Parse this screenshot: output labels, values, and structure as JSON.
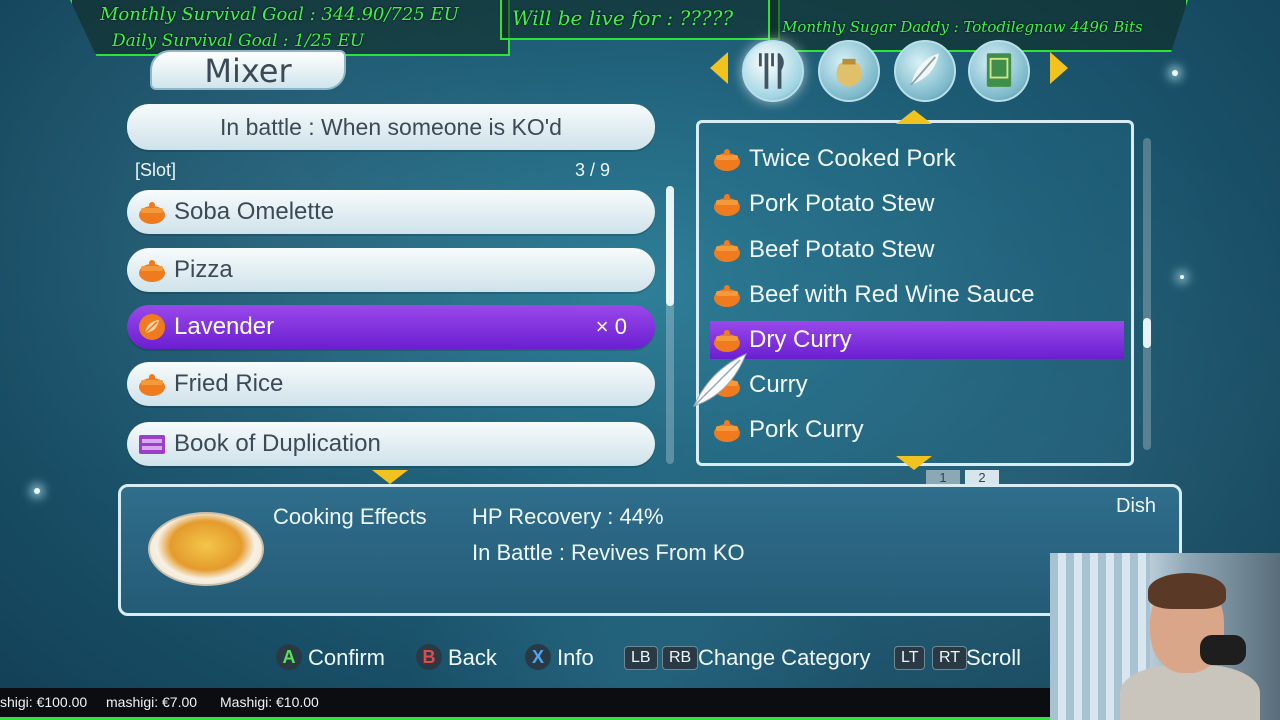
{
  "overlay": {
    "monthly_goal": "Monthly Survival Goal : 344.90/725 EU",
    "daily_goal": "Daily Survival Goal : 1/25 EU",
    "live_for": "Will be live for :   ?????",
    "sugar_daddy": "Monthly Sugar Daddy : Totodilegnaw 4496 Bits"
  },
  "header": {
    "title": "Mixer"
  },
  "trigger": {
    "text": "In battle : When someone is KO'd"
  },
  "slots": {
    "label": "[Slot]",
    "count": "3 / 9",
    "items": [
      {
        "label": "Soba Omelette",
        "icon": "dish-pot-icon"
      },
      {
        "label": "Pizza",
        "icon": "dish-pot-icon"
      },
      {
        "label": "Lavender",
        "icon": "leaf-icon",
        "qty": "× 0",
        "selected": true
      },
      {
        "label": "Fried Rice",
        "icon": "dish-pot-icon"
      },
      {
        "label": "Book of Duplication",
        "icon": "chest-icon"
      }
    ]
  },
  "categories": [
    {
      "name": "fork-knife-icon",
      "active": true
    },
    {
      "name": "pouch-icon"
    },
    {
      "name": "feather-icon"
    },
    {
      "name": "book-icon"
    }
  ],
  "dishes": {
    "items": [
      {
        "label": "Twice Cooked Pork"
      },
      {
        "label": "Pork Potato Stew"
      },
      {
        "label": "Beef Potato Stew"
      },
      {
        "label": "Beef with Red Wine Sauce"
      },
      {
        "label": "Dry Curry",
        "selected": true
      },
      {
        "label": "Curry"
      },
      {
        "label": "Pork Curry"
      }
    ],
    "pages": [
      "1",
      "2"
    ]
  },
  "info": {
    "heading": "Cooking Effects",
    "line1": "HP Recovery : 44%",
    "line2": "In Battle : Revives From KO",
    "type": "Dish"
  },
  "buttons": {
    "a_glyph": "A",
    "confirm": "Confirm",
    "b_glyph": "B",
    "back": "Back",
    "x_glyph": "X",
    "info": "Info",
    "lb": "LB",
    "rb": "RB",
    "change_category": "Change Category",
    "lt": "LT",
    "rt": "RT",
    "scroll": "Scroll"
  },
  "ticker": [
    "shigi: €100.00",
    "mashigi: €7.00",
    "Mashigi: €10.00"
  ],
  "colors": {
    "selection": "#7a2fe0",
    "overlay_green": "#2fe23a",
    "accent_yellow": "#f2c31f"
  }
}
